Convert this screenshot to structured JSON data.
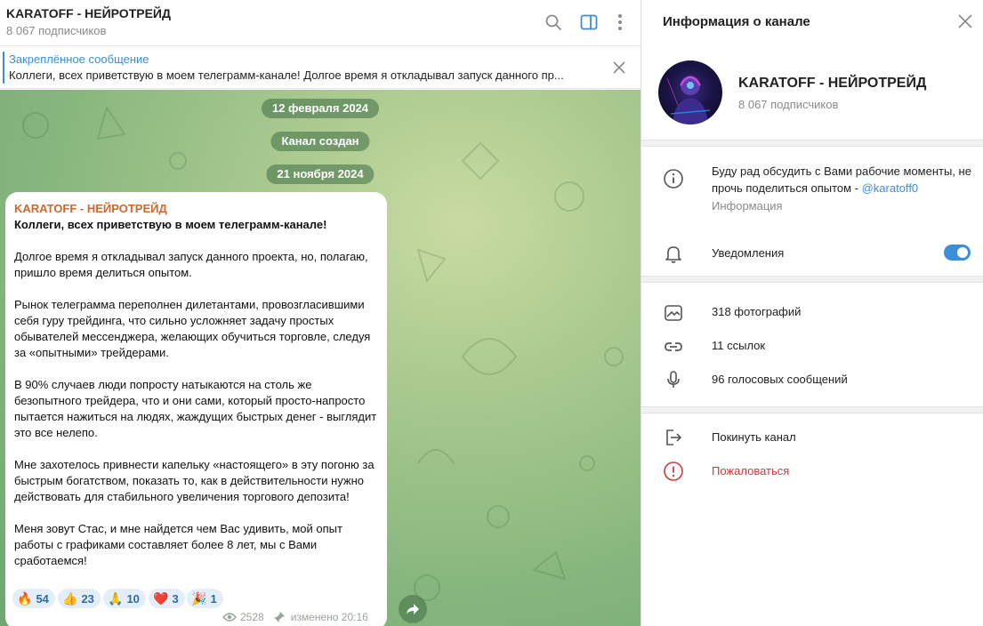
{
  "chat": {
    "title": "KARATOFF - НЕЙРОТРЕЙД",
    "subscribers": "8 067 подписчиков",
    "pinned": {
      "title": "Закреплённое сообщение",
      "text": "Коллеги, всех приветствую в моем телеграмм-канале!  Долгое время я откладывал запуск данного пр..."
    },
    "service_messages": [
      "12 февраля 2024",
      "Канал создан",
      "21 ноября 2024"
    ],
    "message": {
      "author": "KARATOFF - НЕЙРОТРЕЙД",
      "headline": "Коллеги, всех приветствую в моем телеграмм-канале!",
      "paragraphs": [
        "Долгое время я откладывал запуск данного проекта, но, полагаю, пришло время делиться опытом.",
        "Рынок телеграмма переполнен дилетантами, провозгласившими себя гуру трейдинга, что сильно усложняет задачу простых обывателей мессенджера, желающих обучиться торговле, следуя за «опытными» трейдерами.",
        "В 90% случаев люди попросту натыкаются на столь же безопытного трейдера, что и они сами, который просто-напросто пытается нажиться на людях, жаждущих быстрых денег - выглядит это все нелепо.",
        "Мне захотелось привнести капельку «настоящего» в эту погоню за быстрым богатством, показать то, как в действительности нужно действовать для стабильного увеличения торгового депозита!",
        "Меня зовут Стас, и мне найдется чем Вас удивить, мой опыт работы с графиками составляет более 8 лет, мы с Вами сработаемся!"
      ],
      "reactions": [
        {
          "emoji": "🔥",
          "count": "54"
        },
        {
          "emoji": "👍",
          "count": "23"
        },
        {
          "emoji": "🙏",
          "count": "10"
        },
        {
          "emoji": "❤️",
          "count": "3"
        },
        {
          "emoji": "🎉",
          "count": "1"
        }
      ],
      "views": "2528",
      "edited": "изменено 20:16"
    }
  },
  "panel": {
    "title": "Информация о канале",
    "name": "KARATOFF - НЕЙРОТРЕЙД",
    "subscribers": "8 067 подписчиков",
    "about": "Буду рад обсудить с Вами рабочие моменты, не прочь поделиться опытом - ",
    "about_link": "@karatoff0",
    "about_label": "Информация",
    "notifications": "Уведомления",
    "notifications_on": true,
    "photos": "318 фотографий",
    "links": "11 ссылок",
    "voice": "96 голосовых сообщений",
    "leave": "Покинуть канал",
    "report": "Пожаловаться"
  },
  "colors": {
    "accent": "#3a8fd8",
    "author": "#d2672a",
    "danger": "#d23a3a"
  }
}
